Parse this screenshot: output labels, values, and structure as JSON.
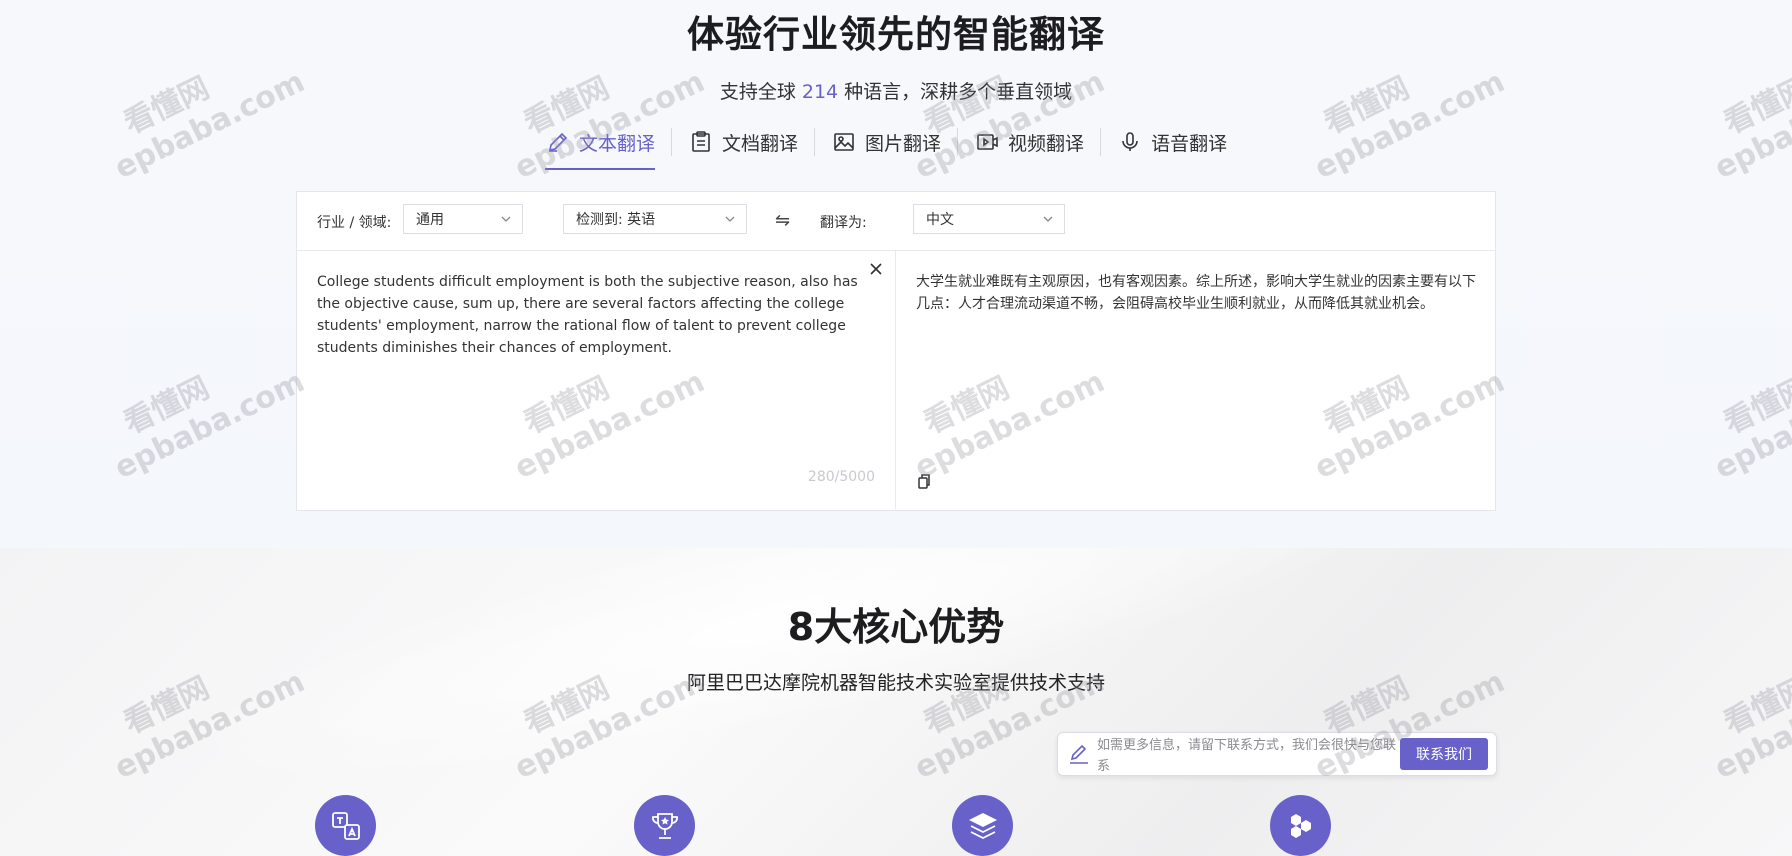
{
  "hero": {
    "title": "体验行业领先的智能翻译",
    "subtitle_pre": "支持全球",
    "subtitle_count": "214",
    "subtitle_post": "种语言，深耕多个垂直领域"
  },
  "tabs": [
    {
      "label": "文本翻译",
      "icon": "pencil-icon",
      "active": true
    },
    {
      "label": "文档翻译",
      "icon": "document-icon",
      "active": false
    },
    {
      "label": "图片翻译",
      "icon": "image-icon",
      "active": false
    },
    {
      "label": "视频翻译",
      "icon": "video-icon",
      "active": false
    },
    {
      "label": "语音翻译",
      "icon": "microphone-icon",
      "active": false
    }
  ],
  "toolbar": {
    "domain_label": "行业 / 领域:",
    "domain_value": "通用",
    "detect_value": "检测到: 英语",
    "swap_icon": "⇋",
    "target_label": "翻译为:",
    "target_value": "中文"
  },
  "source": {
    "text": "College students difficult employment is both the subjective reason, also has the objective cause, sum up, there are several factors affecting the college students' employment, narrow the rational flow of talent to prevent college students diminishes their chances of employment.",
    "counter": "280/5000"
  },
  "target": {
    "text": "大学生就业难既有主观原因，也有客观因素。综上所述，影响大学生就业的因素主要有以下几点：人才合理流动渠道不畅，会阻碍高校毕业生顺利就业，从而降低其就业机会。"
  },
  "section2": {
    "title": "8大核心优势",
    "subtitle": "阿里巴巴达摩院机器智能技术实验室提供技术支持"
  },
  "contact": {
    "placeholder": "如需更多信息，请留下联系方式，我们会很快与您联系",
    "button": "联系我们"
  },
  "features": [
    {
      "icon": "translate-icon"
    },
    {
      "icon": "trophy-icon"
    },
    {
      "icon": "layers-icon"
    },
    {
      "icon": "hexagons-icon"
    }
  ],
  "watermark": {
    "line1": "看懂网",
    "line2": "epbaba.com"
  },
  "colors": {
    "accent": "#6761c9"
  }
}
